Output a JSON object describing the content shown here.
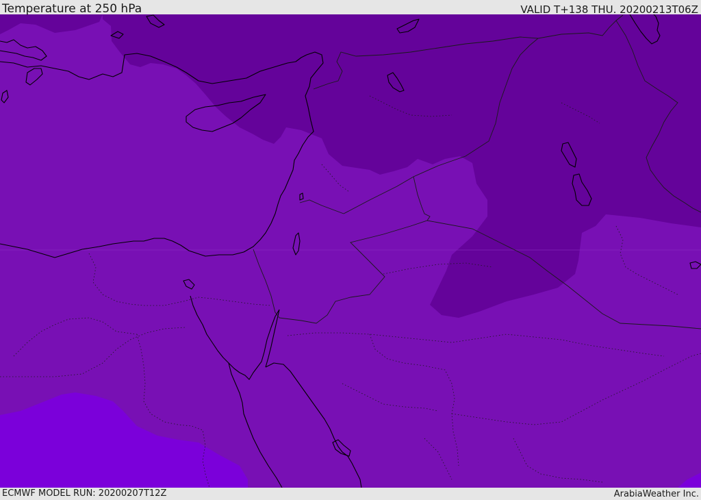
{
  "header": {
    "title": "Temperature at 250 hPa",
    "valid": "VALID T+138 THU. 20200213T06Z"
  },
  "footer": {
    "model_run": "ECMWF MODEL RUN: 20200207T12Z",
    "credit": "ArabiaWeather Inc."
  },
  "map": {
    "colors": {
      "base_zone": "#7810b4",
      "cold_zone": "#64039a",
      "warm_zone": "#7b00da",
      "coastline": "#000000",
      "borders": "#1a1a1a"
    }
  }
}
